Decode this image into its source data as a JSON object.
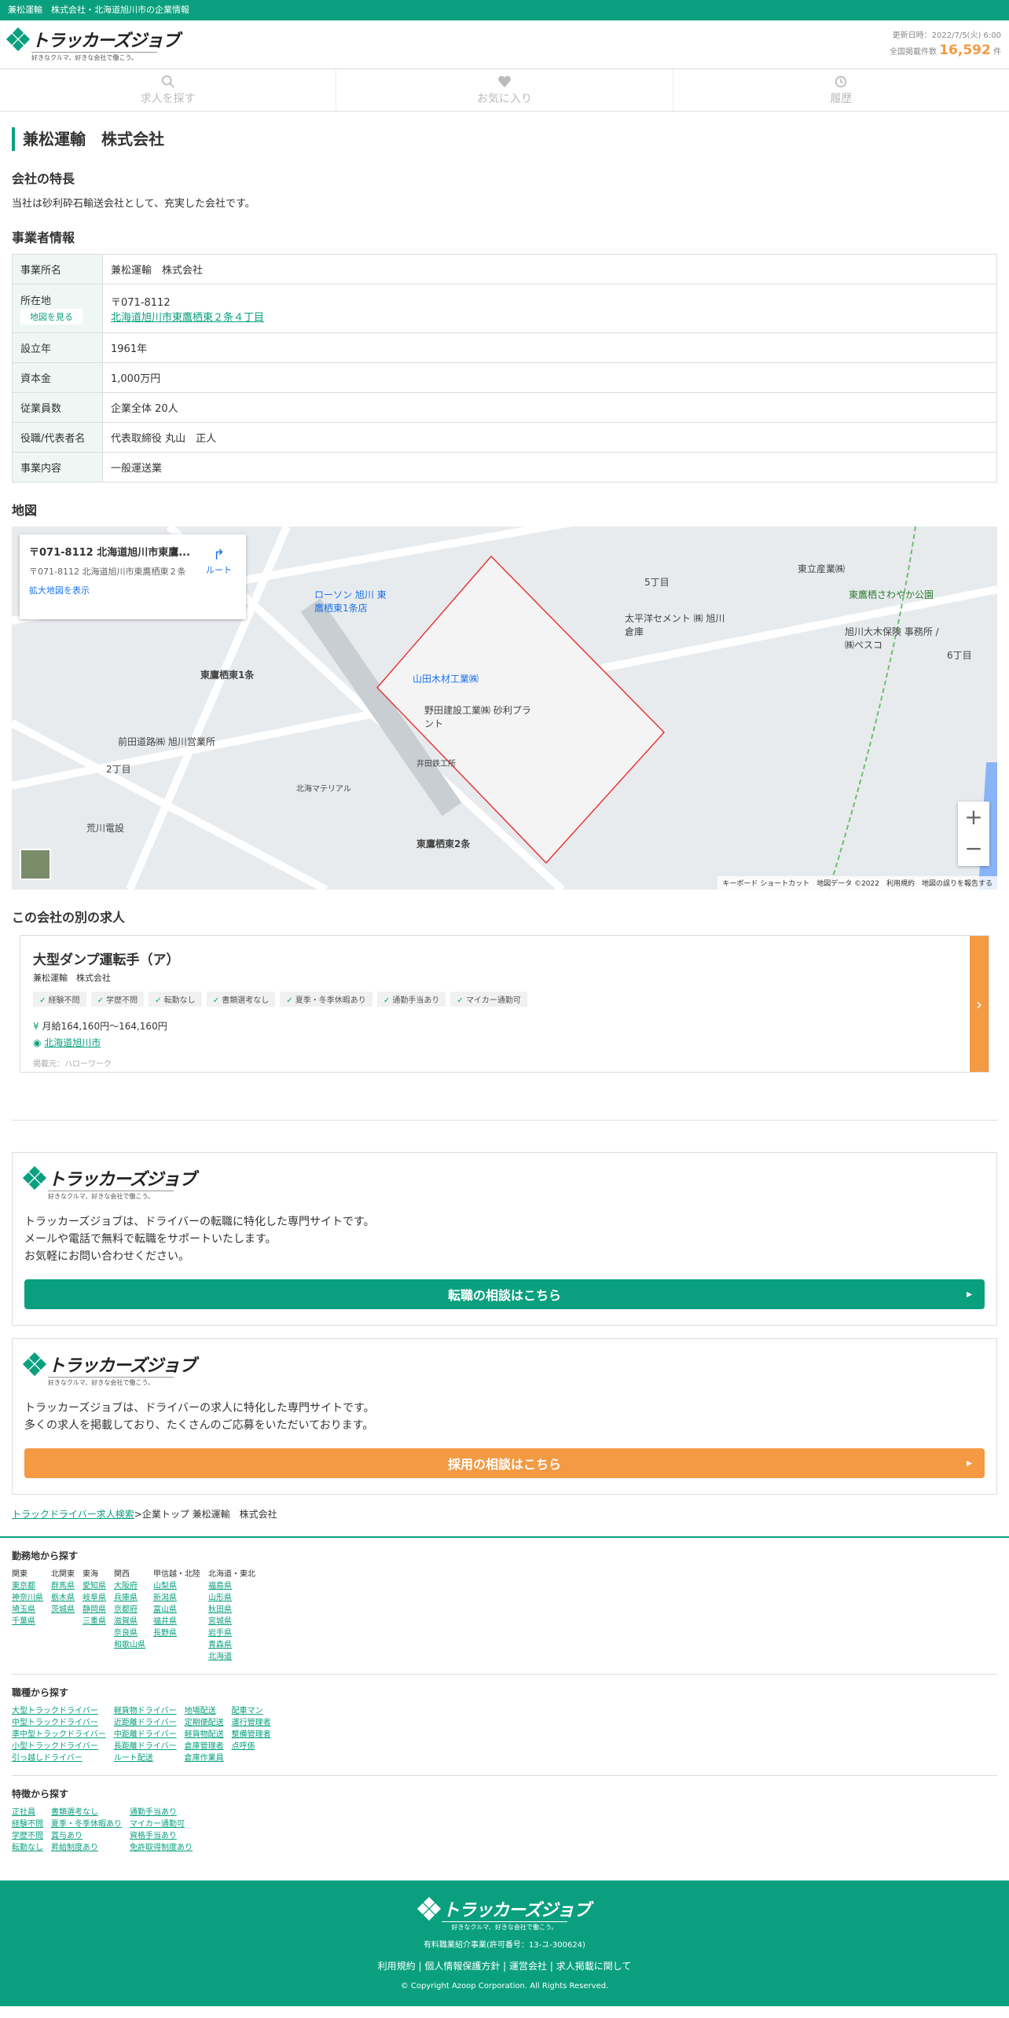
{
  "topbar": "兼松運輸　株式会社・北海道旭川市の企業情報",
  "logo": {
    "text": "トラッカーズジョブ",
    "sub": "好きなクルマ、好きな会社で働こう。"
  },
  "update": {
    "label": "更新日時：2022/7/5(火) 6:00",
    "count_label": "全国掲載件数",
    "count": "16,592",
    "unit": "件"
  },
  "nav": [
    {
      "label": "求人を探す",
      "icon": "search-icon"
    },
    {
      "label": "お気に入り",
      "icon": "heart-icon"
    },
    {
      "label": "履歴",
      "icon": "history-icon"
    }
  ],
  "company": {
    "title": "兼松運輸　株式会社"
  },
  "features": {
    "heading": "会社の特長",
    "text": "当社は砂利砕石輸送会社として、充実した会社です。"
  },
  "info": {
    "heading": "事業者情報",
    "rows": [
      {
        "k": "事業所名",
        "v": "兼松運輸　株式会社"
      },
      {
        "k": "所在地",
        "zip": "〒071-8112",
        "addr": "北海道旭川市東鷹栖東２条４丁目",
        "map_btn": "地図を見る"
      },
      {
        "k": "設立年",
        "v": "1961年"
      },
      {
        "k": "資本金",
        "v": "1,000万円"
      },
      {
        "k": "従業員数",
        "v": "企業全体 20人"
      },
      {
        "k": "役職/代表者名",
        "v": "代表取締役 丸山　正人"
      },
      {
        "k": "事業内容",
        "v": "一般運送業"
      }
    ]
  },
  "map": {
    "heading": "地図",
    "card_title": "〒071-8112 北海道旭川市東鷹...",
    "card_sub": "〒071-8112 北海道旭川市東鷹栖東２条",
    "card_link": "拡大地図を表示",
    "route": "ルート",
    "footer": "キーボード ショートカット　地図データ ©2022　利用規約　地図の誤りを報告する",
    "labels": [
      "東鷹栖東1条",
      "東鷹栖東2条",
      "山田木材工業㈱",
      "野田建設工業㈱ 砂利プラント",
      "太平洋セメント ㈱ 旭川倉庫",
      "5丁目",
      "6丁目",
      "2丁目",
      "旭川大木保険 事務所 / ㈱ペスコ",
      "東鷹栖さわやか公園",
      "東立産業㈱",
      "前田道路㈱ 旭川営業所",
      "荒川電設",
      "北海マテリアル",
      "井田鉄工所",
      "ローソン 旭川 東鷹栖東1条店"
    ]
  },
  "other_jobs": {
    "heading": "この会社の別の求人",
    "job": {
      "title": "大型ダンプ運転手（ア）",
      "company": "兼松運輸　株式会社",
      "tags": [
        "経験不問",
        "学歴不問",
        "転勤なし",
        "書類選考なし",
        "夏季・冬季休暇あり",
        "通勤手当あり",
        "マイカー通勤可"
      ],
      "salary": "月給164,160円〜164,160円",
      "location": "北海道旭川市",
      "source": "掲載元：ハローワーク"
    }
  },
  "promo1": {
    "text": [
      "トラッカーズジョブは、ドライバーの転職に特化した専門サイトです。",
      "メールや電話で無料で転職をサポートいたします。",
      "お気軽にお問い合わせください。"
    ],
    "button": "転職の相談はこちら"
  },
  "promo2": {
    "text": [
      "トラッカーズジョブは、ドライバーの求人に特化した専門サイトです。",
      "多くの求人を掲載しており、たくさんのご応募をいただいております。"
    ],
    "button": "採用の相談はこちら"
  },
  "breadcrumb": {
    "link": "トラックドライバー求人検索",
    "sep": ">",
    "rest": "企業トップ 兼松運輸　株式会社"
  },
  "footer_nav": {
    "area": {
      "heading": "勤務地から探す",
      "cols": [
        {
          "h": "関東",
          "items": [
            "東京都",
            "神奈川県",
            "埼玉県",
            "千葉県"
          ]
        },
        {
          "h": "北関東",
          "items": [
            "群馬県",
            "栃木県",
            "茨城県"
          ]
        },
        {
          "h": "東海",
          "items": [
            "愛知県",
            "岐阜県",
            "静岡県",
            "三重県"
          ]
        },
        {
          "h": "関西",
          "items": [
            "大阪府",
            "兵庫県",
            "京都府",
            "滋賀県",
            "奈良県",
            "和歌山県"
          ]
        },
        {
          "h": "甲信越・北陸",
          "items": [
            "山梨県",
            "新潟県",
            "富山県",
            "福井県",
            "長野県"
          ]
        },
        {
          "h": "北海道・東北",
          "items": [
            "福島県",
            "山形県",
            "秋田県",
            "宮城県",
            "岩手県",
            "青森県",
            "北海道"
          ]
        }
      ]
    },
    "job_type": {
      "heading": "職種から探す",
      "cols": [
        [
          "大型トラックドライバー",
          "中型トラックドライバー",
          "準中型トラックドライバー",
          "小型トラックドライバー",
          "引っ越しドライバー"
        ],
        [
          "軽貨物ドライバー",
          "近距離ドライバー",
          "中距離ドライバー",
          "長距離ドライバー",
          "ルート配送"
        ],
        [
          "地場配送",
          "定期便配送",
          "軽貨物配送",
          "倉庫管理者",
          "倉庫作業員"
        ],
        [
          "配車マン",
          "運行管理者",
          "整備管理者",
          "点呼係"
        ]
      ]
    },
    "feature": {
      "heading": "特徴から探す",
      "cols": [
        [
          "正社員",
          "経験不問",
          "学歴不問",
          "転勤なし"
        ],
        [
          "書類選考なし",
          "夏季・冬季休暇あり",
          "賞与あり",
          "昇給制度あり"
        ],
        [
          "通勤手当あり",
          "マイカー通勤可",
          "資格手当あり",
          "免許取得制度あり"
        ]
      ]
    }
  },
  "footer": {
    "license": "有料職業紹介事業(許可番号：13-ユ-300624)",
    "links": [
      "利用規約",
      "個人情報保護方針",
      "運営会社",
      "求人掲載に関して"
    ],
    "copy": "© Copyright Azoop Corporation. All Rights Reserved."
  },
  "colors": {
    "green": "#0aa07f",
    "orange": "#f39a43"
  }
}
